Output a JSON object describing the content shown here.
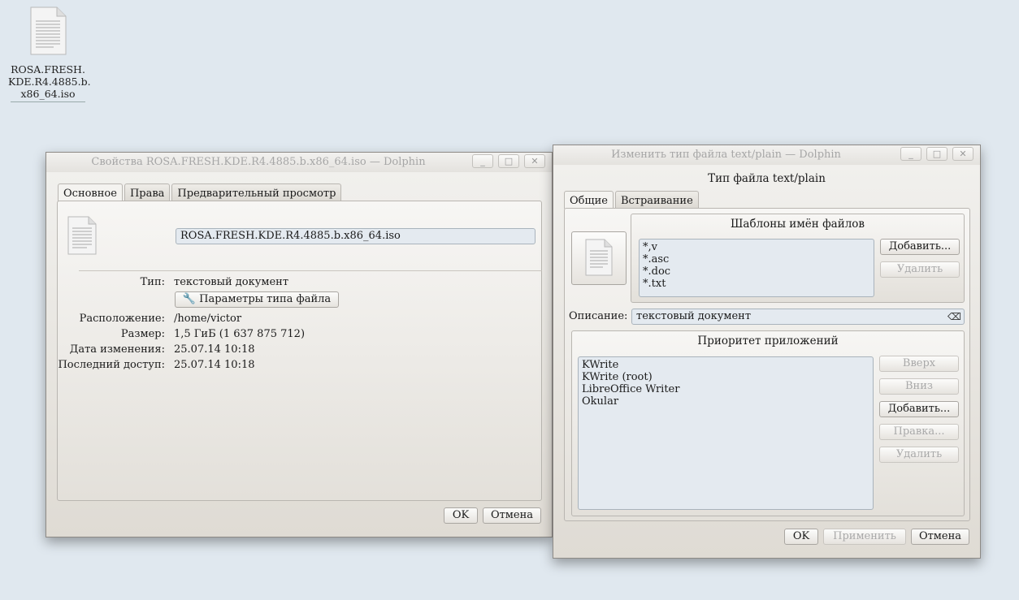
{
  "desktop": {
    "icon_label_lines": [
      "ROSA.FRESH.",
      "KDE.R4.4885.b.",
      "x86_64.iso"
    ]
  },
  "props": {
    "title": "Свойства ROSA.FRESH.KDE.R4.4885.b.x86_64.iso — Dolphin",
    "tabs": [
      "Основное",
      "Права",
      "Предварительный просмотр"
    ],
    "filename": "ROSA.FRESH.KDE.R4.4885.b.x86_64.iso",
    "type_label": "Тип:",
    "type_value": "текстовый документ",
    "filetype_button": "Параметры типа файла",
    "location_label": "Расположение:",
    "location_value": "/home/victor",
    "size_label": "Размер:",
    "size_value": "1,5 ГиБ (1 637 875 712)",
    "modified_label": "Дата изменения:",
    "modified_value": "25.07.14 10:18",
    "accessed_label": "Последний доступ:",
    "accessed_value": "25.07.14 10:18",
    "ok": "OK",
    "cancel": "Отмена"
  },
  "edit": {
    "title": "Изменить тип файла text/plain — Dolphin",
    "heading": "Тип файла text/plain",
    "tabs": [
      "Общие",
      "Встраивание"
    ],
    "patterns_title": "Шаблоны имён файлов",
    "patterns": [
      "*,v",
      "*.asc",
      "*.doc",
      "*.txt"
    ],
    "add": "Добавить...",
    "remove": "Удалить",
    "desc_label": "Описание:",
    "desc_value": "текстовый документ",
    "priority_title": "Приоритет приложений",
    "apps": [
      "KWrite",
      "KWrite (root)",
      "LibreOffice Writer",
      "Okular"
    ],
    "up": "Вверх",
    "down": "Вниз",
    "add2": "Добавить...",
    "edit_btn": "Правка...",
    "remove2": "Удалить",
    "ok": "OK",
    "apply": "Применить",
    "cancel": "Отмена"
  }
}
